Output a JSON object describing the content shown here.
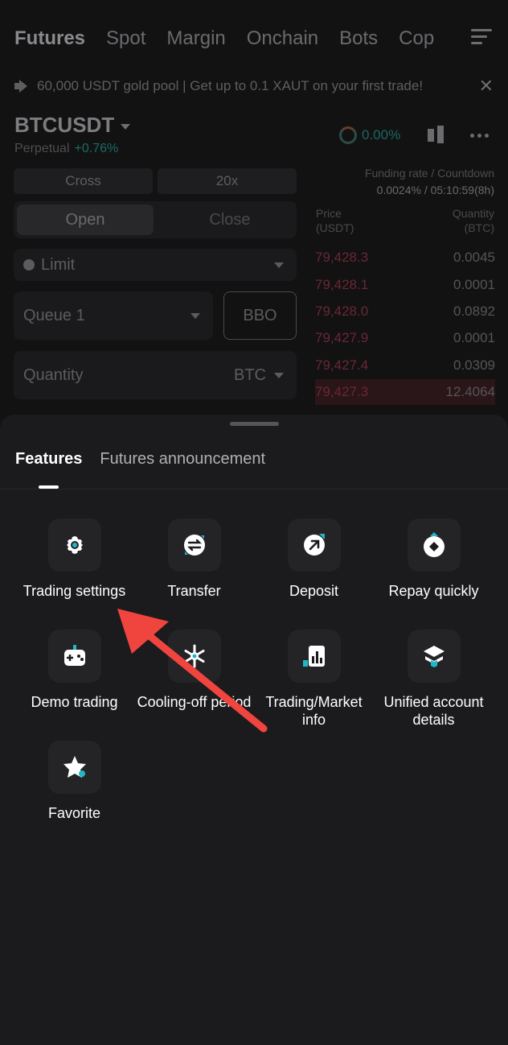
{
  "topnav": [
    "Futures",
    "Spot",
    "Margin",
    "Onchain",
    "Bots",
    "Cop"
  ],
  "banner": {
    "text": "60,000 USDT gold pool | Get up to 0.1 XAUT on your first trade!"
  },
  "ticker": {
    "pair": "BTCUSDT",
    "type": "Perpetual",
    "change": "+0.76%",
    "gauge": "0.00%"
  },
  "controls": {
    "margin_mode": "Cross",
    "leverage": "20x",
    "open": "Open",
    "close": "Close",
    "order_type": "Limit",
    "queue": "Queue 1",
    "bbo": "BBO",
    "quantity_placeholder": "Quantity",
    "quantity_unit": "BTC"
  },
  "funding": {
    "label": "Funding rate / Countdown",
    "value": "0.0024% / 05:10:59(8h)"
  },
  "orderbook": {
    "price_header": "Price\n(USDT)",
    "qty_header": "Quantity\n(BTC)",
    "rows": [
      {
        "price": "79,428.3",
        "qty": "0.0045"
      },
      {
        "price": "79,428.1",
        "qty": "0.0001"
      },
      {
        "price": "79,428.0",
        "qty": "0.0892"
      },
      {
        "price": "79,427.9",
        "qty": "0.0001"
      },
      {
        "price": "79,427.4",
        "qty": "0.0309"
      },
      {
        "price": "79,427.3",
        "qty": "12.4064"
      }
    ]
  },
  "sheet": {
    "tabs": [
      "Features",
      "Futures announcement"
    ],
    "items": [
      {
        "label": "Trading settings",
        "icon": "gear-icon"
      },
      {
        "label": "Transfer",
        "icon": "transfer-icon"
      },
      {
        "label": "Deposit",
        "icon": "deposit-icon"
      },
      {
        "label": "Repay quickly",
        "icon": "repay-icon"
      },
      {
        "label": "Demo trading",
        "icon": "gamepad-icon"
      },
      {
        "label": "Cooling-off period",
        "icon": "snowflake-icon"
      },
      {
        "label": "Trading/Market info",
        "icon": "chart-icon"
      },
      {
        "label": "Unified account details",
        "icon": "layers-icon"
      },
      {
        "label": "Favorite",
        "icon": "star-icon"
      }
    ]
  },
  "colors": {
    "accent": "#1fb8c9",
    "annotation": "#f0453f",
    "sheet_bg": "#1b1b1d"
  }
}
